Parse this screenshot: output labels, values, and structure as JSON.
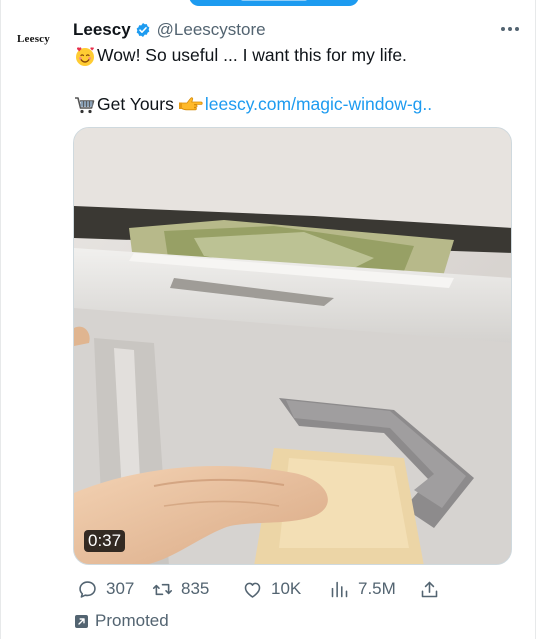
{
  "tweet": {
    "avatar_text": "Leescy",
    "display_name": "Leescy",
    "handle": "@Leescystore",
    "text_line1": "Wow! So useful ... I want this for my life.",
    "text_line2_prefix": "Get Yours",
    "link_text": "leescy.com/magic-window-g.."
  },
  "media": {
    "duration": "0:37"
  },
  "actions": {
    "replies": "307",
    "retweets": "835",
    "likes": "10K",
    "views": "7.5M"
  },
  "footer": {
    "promoted_label": "Promoted"
  },
  "colors": {
    "accent": "#1d9bf0",
    "muted": "#536471",
    "text": "#0f1419"
  },
  "icons": [
    "verified-badge-icon",
    "more-options-icon",
    "smiling-hearts-emoji-icon",
    "shopping-cart-emoji-icon",
    "pointing-hand-emoji-icon",
    "reply-icon",
    "retweet-icon",
    "like-icon",
    "views-icon",
    "share-icon",
    "promoted-icon"
  ]
}
